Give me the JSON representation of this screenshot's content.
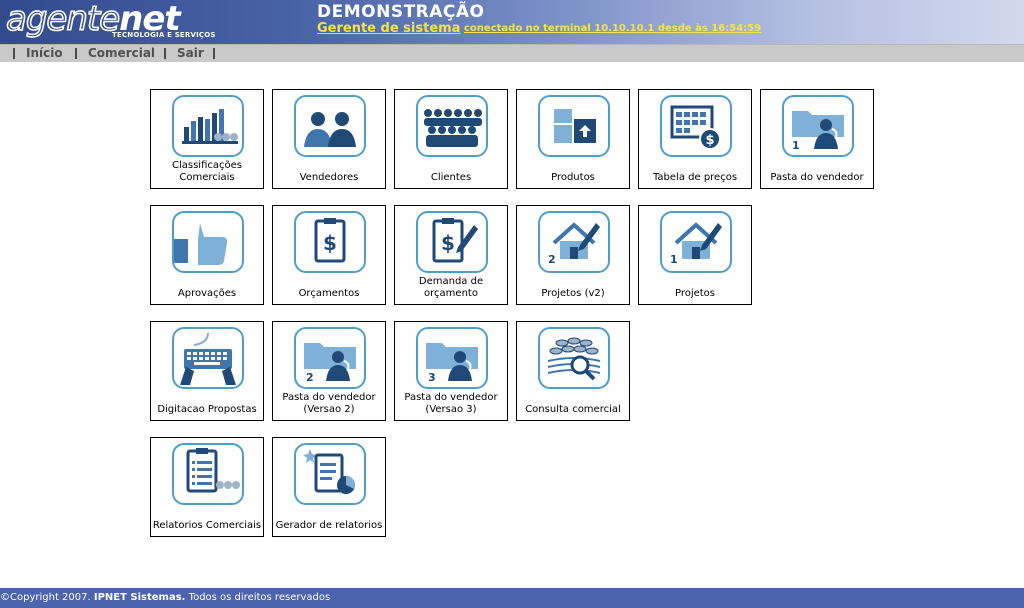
{
  "header": {
    "logo_text_a": "agente",
    "logo_text_b": "net",
    "logo_tagline": "TECNOLOGIA E SERVIÇOS",
    "title": "DEMONSTRAÇÃO",
    "user_role": "Gerente de sistema",
    "connection": "conectado no terminal 10.10.10.1 desde às 16:54:59"
  },
  "menu": {
    "items": [
      {
        "label": "Início"
      },
      {
        "label": "Comercial"
      },
      {
        "label": "Sair"
      }
    ]
  },
  "tiles": [
    {
      "label": "Classificações Comerciais",
      "icon": "bar-chart-icon"
    },
    {
      "label": "Vendedores",
      "icon": "salespeople-icon"
    },
    {
      "label": "Clientes",
      "icon": "crowd-icon"
    },
    {
      "label": "Produtos",
      "icon": "boxes-icon"
    },
    {
      "label": "Tabela de preços",
      "icon": "price-table-icon"
    },
    {
      "label": "Pasta do vendedor",
      "icon": "seller-folder-icon"
    },
    {
      "label": "Aprovações",
      "icon": "thumbs-up-icon"
    },
    {
      "label": "Orçamentos",
      "icon": "clipboard-dollar-icon"
    },
    {
      "label": "Demanda de orçamento",
      "icon": "clipboard-pen-icon"
    },
    {
      "label": "Projetos (v2)",
      "icon": "house-pen-icon"
    },
    {
      "label": "Projetos",
      "icon": "house-pen-icon"
    },
    {
      "label": "Digitacao Propostas",
      "icon": "keyboard-icon"
    },
    {
      "label": "Pasta do vendedor (Versao 2)",
      "icon": "seller-folder-icon"
    },
    {
      "label": "Pasta do vendedor (Versao 3)",
      "icon": "seller-folder-icon"
    },
    {
      "label": "Consulta comercial",
      "icon": "coins-search-icon"
    },
    {
      "label": "Relatorios Comerciais",
      "icon": "report-list-icon"
    },
    {
      "label": "Gerador de relatorios",
      "icon": "report-generator-icon"
    }
  ],
  "badges": {
    "pasta_do_vendedor": "1",
    "projetos_v2": "2",
    "projetos": "1",
    "pasta_v2": "2",
    "pasta_v3": "3"
  },
  "footer": {
    "copyright": "©Copyright 2007.",
    "company": "IPNET Sistemas.",
    "rights": "Todos os direitos reservados"
  },
  "colors": {
    "header_dark": "#324a8e",
    "accent_yellow": "#f6e34a",
    "icon_blue": "#1f4a78",
    "icon_border": "#4d9fc9",
    "footer": "#4c64ad"
  }
}
